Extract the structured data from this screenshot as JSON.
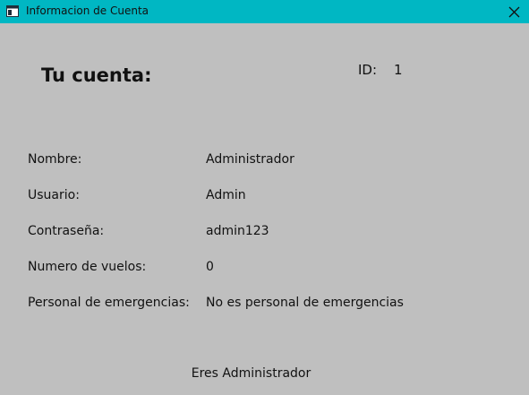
{
  "window": {
    "title": "Informacion de Cuenta",
    "app_icon": "window-icon",
    "close_icon": "close-icon",
    "titlebar_color": "#00b7c3",
    "background_color": "#bfbfbf"
  },
  "account": {
    "heading": "Tu cuenta:",
    "id_label": "ID:",
    "id_value": "1",
    "fields": [
      {
        "label": "Nombre:",
        "value": "Administrador"
      },
      {
        "label": "Usuario:",
        "value": "Admin"
      },
      {
        "label": "Contraseña:",
        "value": "admin123"
      },
      {
        "label": "Numero de vuelos:",
        "value": "0"
      },
      {
        "label": "Personal de emergencias:",
        "value": "No es personal de emergencias"
      }
    ],
    "role_text": "Eres Administrador"
  }
}
